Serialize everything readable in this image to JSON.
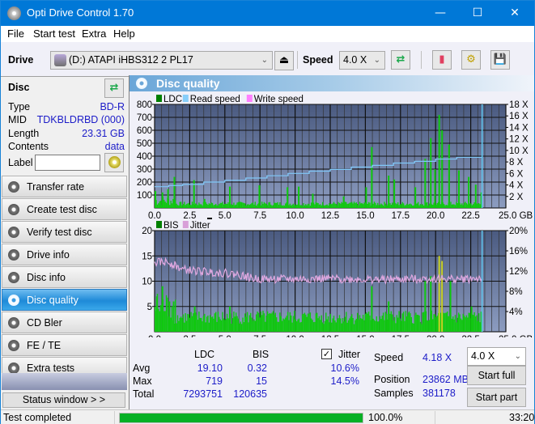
{
  "window": {
    "title": "Opti Drive Control 1.70",
    "controls": [
      "minimize",
      "maximize",
      "close"
    ]
  },
  "menu": [
    "File",
    "Start test",
    "Extra",
    "Help"
  ],
  "toolbar": {
    "drive_label": "Drive",
    "drive_value": "(D:)  ATAPI iHBS312  2 PL17",
    "speed_label": "Speed",
    "speed_value": "4.0 X",
    "icons": [
      "eject-icon",
      "refresh-icon",
      "erase-icon",
      "settings-icon",
      "save-icon"
    ]
  },
  "disc": {
    "header": "Disc",
    "fields": [
      {
        "key": "Type",
        "value": "BD-R"
      },
      {
        "key": "MID",
        "value": "TDKBLDRBD (000)"
      },
      {
        "key": "Length",
        "value": "23.31 GB"
      },
      {
        "key": "Contents",
        "value": "data"
      }
    ],
    "label_key": "Label",
    "label_value": ""
  },
  "nav": [
    {
      "label": "Transfer rate",
      "active": false
    },
    {
      "label": "Create test disc",
      "active": false
    },
    {
      "label": "Verify test disc",
      "active": false
    },
    {
      "label": "Drive info",
      "active": false
    },
    {
      "label": "Disc info",
      "active": false
    },
    {
      "label": "Disc quality",
      "active": true
    },
    {
      "label": "CD Bler",
      "active": false
    },
    {
      "label": "FE / TE",
      "active": false
    },
    {
      "label": "Extra tests",
      "active": false
    }
  ],
  "status_window_label": "Status window > >",
  "panel_title": "Disc quality",
  "chart_data": [
    {
      "type": "bar",
      "title": "LDC / Read speed",
      "legend": [
        {
          "name": "LDC",
          "color": "#008000"
        },
        {
          "name": "Read speed",
          "color": "#87cefa"
        },
        {
          "name": "Write speed",
          "color": "#ff80ff"
        }
      ],
      "legend_position": "top-left",
      "xlabel": "GB",
      "xlim": [
        0,
        25
      ],
      "x_ticks": [
        "0.0",
        "2.5",
        "5.0",
        "7.5",
        "10.0",
        "12.5",
        "15.0",
        "17.5",
        "20.0",
        "22.5",
        "25.0 GB"
      ],
      "ylim_left": [
        0,
        800
      ],
      "y_ticks_left": [
        "100",
        "200",
        "300",
        "400",
        "500",
        "600",
        "700",
        "800"
      ],
      "ylim_right": [
        0,
        18
      ],
      "y_ticks_right": [
        "2 X",
        "4 X",
        "6 X",
        "8 X",
        "10 X",
        "12 X",
        "14 X",
        "16 X",
        "18 X"
      ],
      "grid": true,
      "end_marker_gb": 23.31,
      "ldc_spikes": [
        {
          "x": 0.0,
          "y": 130
        },
        {
          "x": 0.5,
          "y": 120
        },
        {
          "x": 0.9,
          "y": 145
        },
        {
          "x": 1.35,
          "y": 240
        },
        {
          "x": 2.75,
          "y": 215
        },
        {
          "x": 3.5,
          "y": 70
        },
        {
          "x": 5.3,
          "y": 165
        },
        {
          "x": 7.4,
          "y": 175
        },
        {
          "x": 9.4,
          "y": 160
        },
        {
          "x": 10.2,
          "y": 165
        },
        {
          "x": 11.2,
          "y": 110
        },
        {
          "x": 13.4,
          "y": 90
        },
        {
          "x": 15.0,
          "y": 160
        },
        {
          "x": 15.4,
          "y": 470
        },
        {
          "x": 16.6,
          "y": 250
        },
        {
          "x": 17.0,
          "y": 220
        },
        {
          "x": 18.5,
          "y": 160
        },
        {
          "x": 19.2,
          "y": 380
        },
        {
          "x": 19.6,
          "y": 540
        },
        {
          "x": 19.9,
          "y": 300
        },
        {
          "x": 20.2,
          "y": 719
        },
        {
          "x": 20.4,
          "y": 600
        },
        {
          "x": 20.9,
          "y": 490
        },
        {
          "x": 21.6,
          "y": 290
        },
        {
          "x": 22.3,
          "y": 240
        },
        {
          "x": 22.8,
          "y": 180
        },
        {
          "x": 23.2,
          "y": 120
        }
      ],
      "ldc_baseline": 35,
      "read_speed": [
        {
          "x": 0.0,
          "y": 3.7
        },
        {
          "x": 1.0,
          "y": 3.9
        },
        {
          "x": 2.0,
          "y": 4.1
        },
        {
          "x": 3.5,
          "y": 4.5
        },
        {
          "x": 5.0,
          "y": 4.8
        },
        {
          "x": 6.5,
          "y": 5.2
        },
        {
          "x": 8.0,
          "y": 5.6
        },
        {
          "x": 9.5,
          "y": 6.0
        },
        {
          "x": 11.0,
          "y": 6.4
        },
        {
          "x": 12.5,
          "y": 6.7
        },
        {
          "x": 14.0,
          "y": 7.1
        },
        {
          "x": 15.5,
          "y": 7.4
        },
        {
          "x": 17.0,
          "y": 7.8
        },
        {
          "x": 18.5,
          "y": 8.1
        },
        {
          "x": 20.0,
          "y": 8.5
        },
        {
          "x": 21.5,
          "y": 8.8
        },
        {
          "x": 23.31,
          "y": 9.1
        }
      ]
    },
    {
      "type": "bar",
      "title": "BIS / Jitter",
      "legend": [
        {
          "name": "BIS",
          "color": "#008000"
        },
        {
          "name": "Jitter",
          "color": "#d8a0d8"
        }
      ],
      "legend_position": "top-left",
      "xlabel": "GB",
      "xlim": [
        0,
        25
      ],
      "x_ticks": [
        "0.0",
        "2.5",
        "5.0",
        "7.5",
        "10.0",
        "12.5",
        "15.0",
        "17.5",
        "20.0",
        "22.5",
        "25.0 GB"
      ],
      "ylim_left": [
        0,
        20
      ],
      "y_ticks_left": [
        "5",
        "10",
        "15",
        "20"
      ],
      "ylim_right": [
        0,
        20
      ],
      "y_ticks_right": [
        "4%",
        "8%",
        "12%",
        "16%",
        "20%"
      ],
      "grid": true,
      "end_marker_gb": 23.31,
      "bis_spikes": [
        {
          "x": 0.1,
          "y": 7
        },
        {
          "x": 0.5,
          "y": 9
        },
        {
          "x": 1.0,
          "y": 6
        },
        {
          "x": 1.3,
          "y": 6
        },
        {
          "x": 2.8,
          "y": 5
        },
        {
          "x": 5.3,
          "y": 5
        },
        {
          "x": 15.4,
          "y": 9
        },
        {
          "x": 16.6,
          "y": 6
        },
        {
          "x": 19.2,
          "y": 10
        },
        {
          "x": 19.6,
          "y": 11
        },
        {
          "x": 20.2,
          "y": 15
        },
        {
          "x": 20.4,
          "y": 14
        },
        {
          "x": 21.0,
          "y": 10
        },
        {
          "x": 22.5,
          "y": 5
        }
      ],
      "bis_baseline": 3,
      "jitter": [
        {
          "x": 0.0,
          "y": 13.7
        },
        {
          "x": 1.0,
          "y": 13.8
        },
        {
          "x": 2.0,
          "y": 12.3
        },
        {
          "x": 3.0,
          "y": 12.0
        },
        {
          "x": 4.0,
          "y": 11.8
        },
        {
          "x": 5.0,
          "y": 11.6
        },
        {
          "x": 6.0,
          "y": 11.3
        },
        {
          "x": 7.0,
          "y": 10.5
        },
        {
          "x": 8.0,
          "y": 10.4
        },
        {
          "x": 10.0,
          "y": 10.4
        },
        {
          "x": 12.0,
          "y": 10.5
        },
        {
          "x": 14.0,
          "y": 10.4
        },
        {
          "x": 16.0,
          "y": 10.3
        },
        {
          "x": 18.0,
          "y": 10.4
        },
        {
          "x": 20.0,
          "y": 10.5
        },
        {
          "x": 22.0,
          "y": 10.4
        },
        {
          "x": 23.31,
          "y": 10.6
        }
      ]
    }
  ],
  "stats": {
    "col_ldc": "LDC",
    "col_bis": "BIS",
    "jitter_checked": true,
    "jitter_label": "Jitter",
    "rows": [
      {
        "label": "Avg",
        "ldc": "19.10",
        "bis": "0.32",
        "jitter": "10.6%"
      },
      {
        "label": "Max",
        "ldc": "719",
        "bis": "15",
        "jitter": "14.5%"
      },
      {
        "label": "Total",
        "ldc": "7293751",
        "bis": "120635",
        "jitter": ""
      }
    ],
    "speed_label": "Speed",
    "speed_value": "4.18 X",
    "position_label": "Position",
    "position_value": "23862 MB",
    "samples_label": "Samples",
    "samples_value": "381178",
    "speed_select": "4.0 X",
    "start_full": "Start full",
    "start_part": "Start part"
  },
  "statusbar": {
    "text": "Test completed",
    "progress": 100.0,
    "progress_text": "100.0%",
    "time": "33:20"
  }
}
